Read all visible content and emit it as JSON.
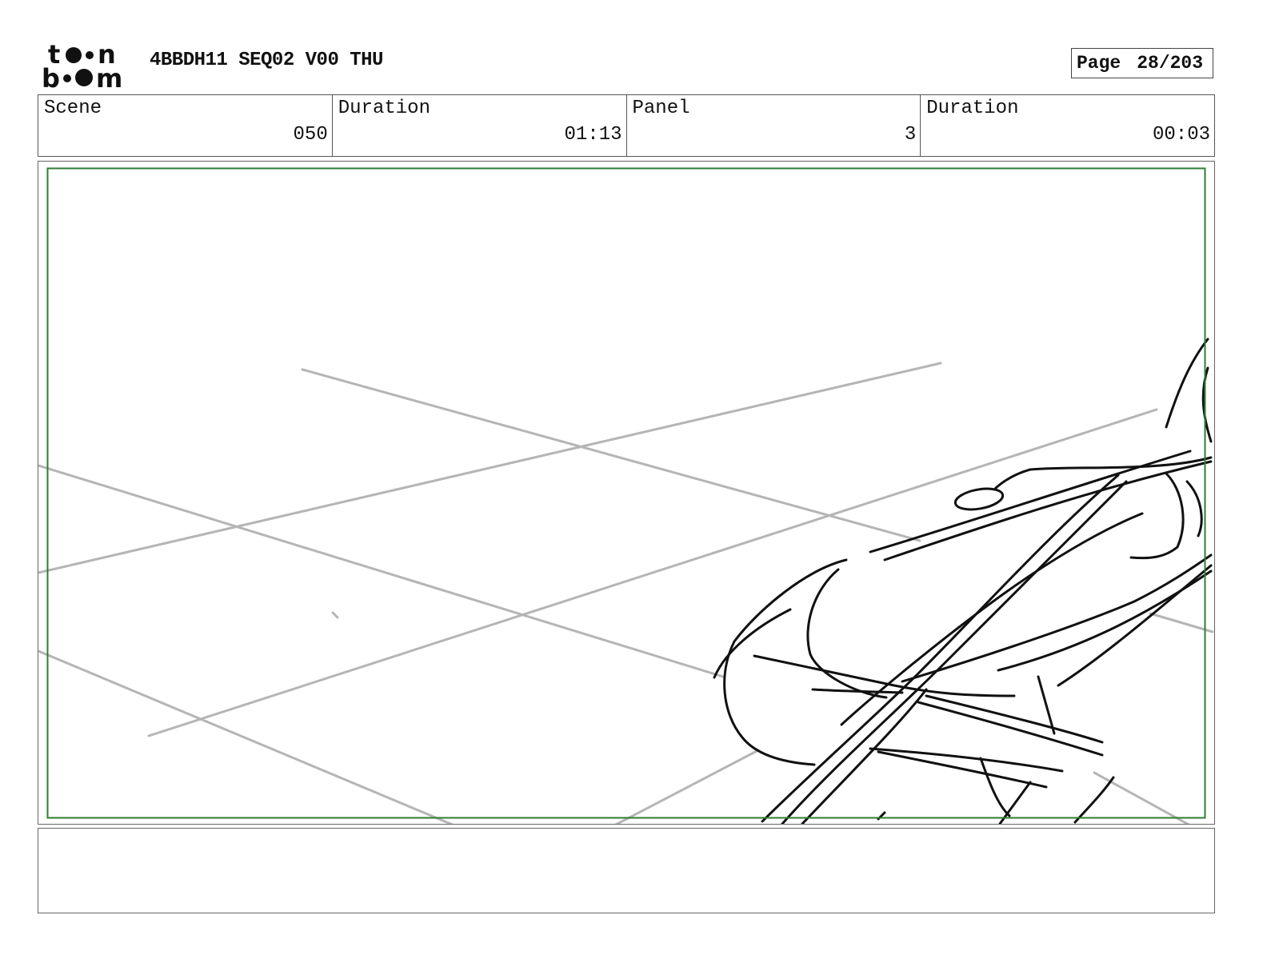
{
  "header": {
    "logo_text": "toon boom",
    "document_title": "4BBDH11 SEQ02 V00 THU",
    "page_label": "Page",
    "page_number": "28/203"
  },
  "info": {
    "scene_label": "Scene",
    "scene_value": "050",
    "scene_duration_label": "Duration",
    "scene_duration_value": "01:13",
    "panel_label": "Panel",
    "panel_value": "3",
    "panel_duration_label": "Duration",
    "panel_duration_value": "00:03"
  },
  "panel": {
    "safe_frame_color": "#2e7d32",
    "guide_line_color": "#b5b5b5",
    "sketch_color": "#111111"
  },
  "notes": {
    "text": ""
  }
}
